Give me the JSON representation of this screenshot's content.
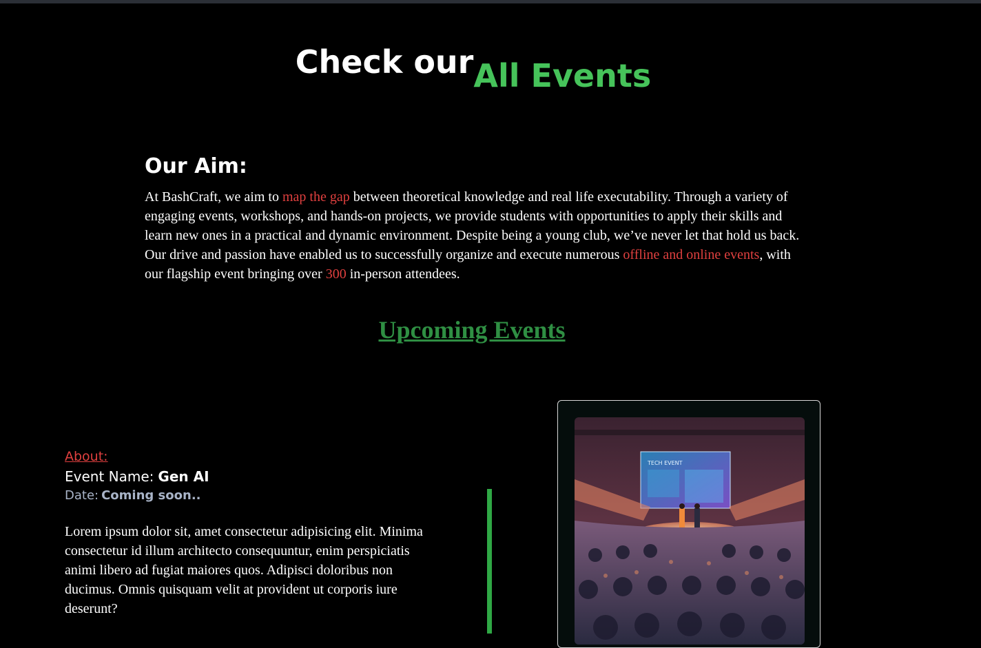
{
  "hero": {
    "title_part1": "Check our",
    "title_part2": "All Events"
  },
  "aim": {
    "heading": "Our Aim:",
    "text_1": "At BashCraft, we aim to ",
    "highlight_1": "map the gap",
    "text_2": " between theoretical knowledge and real life executability. Through a variety of engaging events, workshops, and hands-on projects, we provide students with opportunities to apply their skills and learn new ones in a practical and dynamic environment. Despite being a young club, we’ve never let that hold us back. Our drive and passion have enabled us to successfully organize and execute numerous ",
    "highlight_2": "offline and online events",
    "text_3": ", with our flagship event bringing over ",
    "highlight_3": "300",
    "text_4": " in-person attendees."
  },
  "upcoming": {
    "heading": "Upcoming Events"
  },
  "event": {
    "about_label": "About:",
    "name_label": "Event Name:",
    "name_value": "Gen AI",
    "date_label": "Date:",
    "date_value": "Coming soon..",
    "description": "Lorem ipsum dolor sit, amet consectetur adipisicing elit. Minima consectetur id illum architecto consequuntur, enim perspiciatis animi libero ad fugiat maiores quos. Adipisci doloribus non ducimus. Omnis quisquam velit at provident ut corporis iure deserunt?",
    "image_screen_text": "TECH EVENT"
  },
  "colors": {
    "accent_green": "#46c35a",
    "heading_green": "#2f8f43",
    "highlight_red": "#e0403f",
    "bar_green": "#2fa845"
  }
}
